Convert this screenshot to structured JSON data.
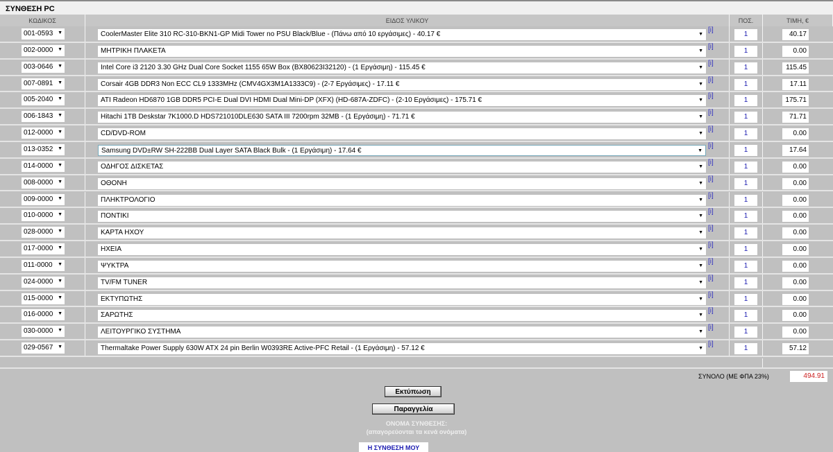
{
  "title": "ΣΥΝΘΕΣΗ PC",
  "headers": {
    "code": "ΚΩΔΙΚΟΣ",
    "item": "ΕΙΔΟΣ ΥΛΙΚΟΥ",
    "qty": "ΠΟΣ.",
    "price": "ΤΙΜΗ, €"
  },
  "info_label": "[i]",
  "rows": [
    {
      "code": "001-0593",
      "item": "CoolerMaster Elite 310 RC-310-BKN1-GP Midi Tower no PSU Black/Blue - (Πάνω από 10 εργάσιμες) - 40.17 €",
      "qty": "1",
      "price": "40.17"
    },
    {
      "code": "002-0000",
      "item": "ΜΗΤΡΙΚΗ ΠΛΑΚΕΤΑ",
      "qty": "1",
      "price": "0.00"
    },
    {
      "code": "003-0646",
      "item": "Intel Core i3 2120 3.30 GHz Dual Core Socket 1155 65W Box (BX80623I32120) - (1 Εργάσιμη) - 115.45 €",
      "qty": "1",
      "price": "115.45"
    },
    {
      "code": "007-0891",
      "item": "Corsair 4GB DDR3 Non ECC CL9 1333MHz (CMV4GX3M1A1333C9) - (2-7 Εργάσιμες) - 17.11 €",
      "qty": "1",
      "price": "17.11"
    },
    {
      "code": "005-2040",
      "item": "ATI Radeon HD6870 1GB DDR5 PCI-E Dual DVI HDMI Dual Mini-DP (XFX) (HD-687A-ZDFC) - (2-10 Εργάσιμες) - 175.71 €",
      "qty": "1",
      "price": "175.71"
    },
    {
      "code": "006-1843",
      "item": "Hitachi 1TB Deskstar 7K1000.D HDS721010DLE630 SATA III 7200rpm 32MB - (1 Εργάσιμη) - 71.71 €",
      "qty": "1",
      "price": "71.71"
    },
    {
      "code": "012-0000",
      "item": "CD/DVD-ROM",
      "qty": "1",
      "price": "0.00"
    },
    {
      "code": "013-0352",
      "item": "Samsung DVD±RW SH-222BB Dual Layer SATA Black Bulk - (1 Εργάσιμη) - 17.64 €",
      "qty": "1",
      "price": "17.64",
      "selected": true
    },
    {
      "code": "014-0000",
      "item": "ΟΔΗΓΟΣ ΔΙΣΚΕΤΑΣ",
      "qty": "1",
      "price": "0.00"
    },
    {
      "code": "008-0000",
      "item": "ΟΘΟΝΗ",
      "qty": "1",
      "price": "0.00"
    },
    {
      "code": "009-0000",
      "item": "ΠΛΗΚΤΡΟΛΟΓΙΟ",
      "qty": "1",
      "price": "0.00"
    },
    {
      "code": "010-0000",
      "item": "ΠΟΝΤΙΚΙ",
      "qty": "1",
      "price": "0.00"
    },
    {
      "code": "028-0000",
      "item": "ΚΑΡΤΑ ΗΧΟΥ",
      "qty": "1",
      "price": "0.00"
    },
    {
      "code": "017-0000",
      "item": "ΗΧΕΙΑ",
      "qty": "1",
      "price": "0.00"
    },
    {
      "code": "011-0000",
      "item": "ΨΥΚΤΡΑ",
      "qty": "1",
      "price": "0.00"
    },
    {
      "code": "024-0000",
      "item": "TV/FM TUNER",
      "qty": "1",
      "price": "0.00"
    },
    {
      "code": "015-0000",
      "item": "ΕΚΤΥΠΩΤΗΣ",
      "qty": "1",
      "price": "0.00"
    },
    {
      "code": "016-0000",
      "item": "ΣΑΡΩΤΗΣ",
      "qty": "1",
      "price": "0.00"
    },
    {
      "code": "030-0000",
      "item": "ΛΕΙΤΟΥΡΓΙΚΟ ΣΥΣΤΗΜΑ",
      "qty": "1",
      "price": "0.00"
    },
    {
      "code": "029-0567",
      "item": "Thermaltake Power Supply 630W ATX 24 pin Berlin W0393RE Active-PFC Retail - (1 Εργάσιμη) - 57.12 €",
      "qty": "1",
      "price": "57.12"
    }
  ],
  "total": {
    "label": "ΣΥΝΟΛΟ (ΜΕ ΦΠΑ 23%)",
    "value": "494.91",
    "color": "#cc2020"
  },
  "buttons": {
    "print": "Εκτύπωση",
    "order": "Παραγγελία"
  },
  "config_name": {
    "label": "ΟΝΟΜΑ ΣΥΝΘΕΣΗΣ:",
    "hint": "(απαγορεύονται τα κενά ονόματα)",
    "value": "Η ΣΥΝΘΕΣΗ ΜΟΥ"
  }
}
